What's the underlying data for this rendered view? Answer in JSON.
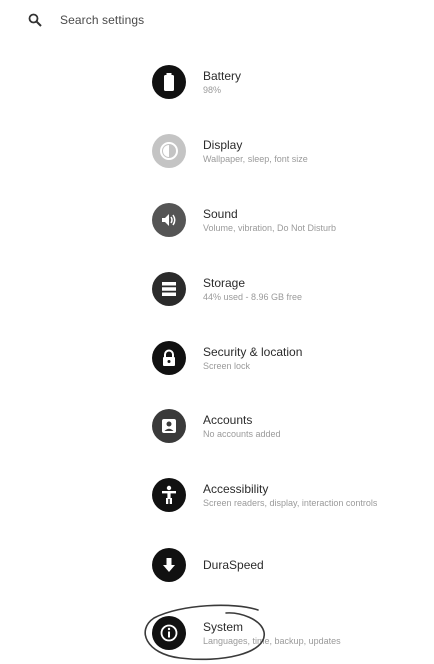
{
  "search": {
    "placeholder": "Search settings",
    "icon": "search-icon"
  },
  "items": [
    {
      "title": "Battery",
      "subtitle": "98%",
      "icon": "battery-icon",
      "color": "#111111"
    },
    {
      "title": "Display",
      "subtitle": "Wallpaper, sleep, font size",
      "icon": "display-icon",
      "color": "#bdbdbd"
    },
    {
      "title": "Sound",
      "subtitle": "Volume, vibration, Do Not Disturb",
      "icon": "sound-icon",
      "color": "#555555"
    },
    {
      "title": "Storage",
      "subtitle": "44% used - 8.96 GB free",
      "icon": "storage-icon",
      "color": "#2b2b2b"
    },
    {
      "title": "Security & location",
      "subtitle": "Screen lock",
      "icon": "lock-icon",
      "color": "#111111"
    },
    {
      "title": "Accounts",
      "subtitle": "No accounts added",
      "icon": "accounts-icon",
      "color": "#3a3a3a"
    },
    {
      "title": "Accessibility",
      "subtitle": "Screen readers, display, interaction controls",
      "icon": "accessibility-icon",
      "color": "#111111"
    },
    {
      "title": "DuraSpeed",
      "subtitle": "",
      "icon": "duraspeed-icon",
      "color": "#111111"
    },
    {
      "title": "System",
      "subtitle": "Languages, time, backup, updates",
      "icon": "system-info-icon",
      "color": "#111111"
    }
  ]
}
